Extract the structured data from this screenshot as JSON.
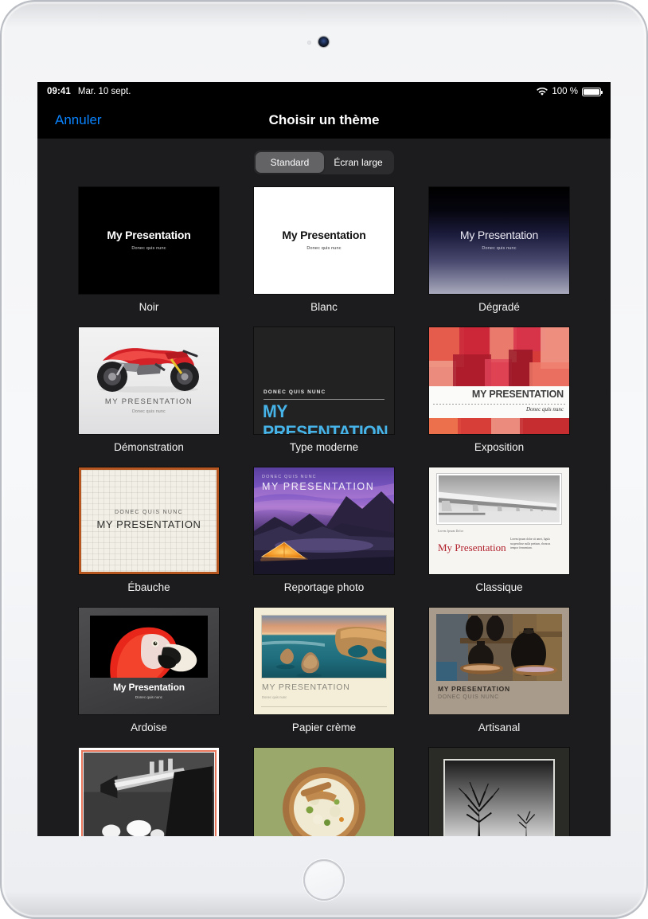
{
  "status_bar": {
    "time": "09:41",
    "date": "Mar. 10 sept.",
    "wifi_icon": "wifi-icon",
    "battery_percent": "100 %",
    "battery_icon": "battery-full-icon"
  },
  "nav_bar": {
    "cancel_label": "Annuler",
    "title": "Choisir un thème",
    "tint_color": "#0a84ff"
  },
  "segmented_control": {
    "options": [
      {
        "label": "Standard",
        "selected": true
      },
      {
        "label": "Écran large",
        "selected": false
      }
    ]
  },
  "slide_text": {
    "title": "My Presentation",
    "title_upper": "MY PRESENTATION",
    "subtitle": "Donec quis nunc",
    "subtitle_upper": "DONEC QUIS NUNC",
    "lorem_caption": "Lorem Ipsum Dolor",
    "lorem_body": "Lorem ipsum dolor sit amet, ligula suspendisse nulla pretium, rhoncus tempor fermentum."
  },
  "themes": [
    {
      "name": "Noir",
      "row": 1,
      "col": 1
    },
    {
      "name": "Blanc",
      "row": 1,
      "col": 2
    },
    {
      "name": "Dégradé",
      "row": 1,
      "col": 3
    },
    {
      "name": "Démonstration",
      "row": 2,
      "col": 1
    },
    {
      "name": "Type moderne",
      "row": 2,
      "col": 2
    },
    {
      "name": "Exposition",
      "row": 2,
      "col": 3
    },
    {
      "name": "Ébauche",
      "row": 3,
      "col": 1
    },
    {
      "name": "Reportage photo",
      "row": 3,
      "col": 2
    },
    {
      "name": "Classique",
      "row": 3,
      "col": 3
    },
    {
      "name": "Ardoise",
      "row": 4,
      "col": 1
    },
    {
      "name": "Papier crème",
      "row": 4,
      "col": 2
    },
    {
      "name": "Artisanal",
      "row": 4,
      "col": 3
    }
  ],
  "colors": {
    "screen_background": "#1c1c1e",
    "bar_background": "#000000",
    "accent_blue": "#0a84ff",
    "segment_selected": "#636366",
    "moderne_cyan": "#46b4e8",
    "classique_red": "#b0202b",
    "ebauche_border": "#b5551f"
  }
}
